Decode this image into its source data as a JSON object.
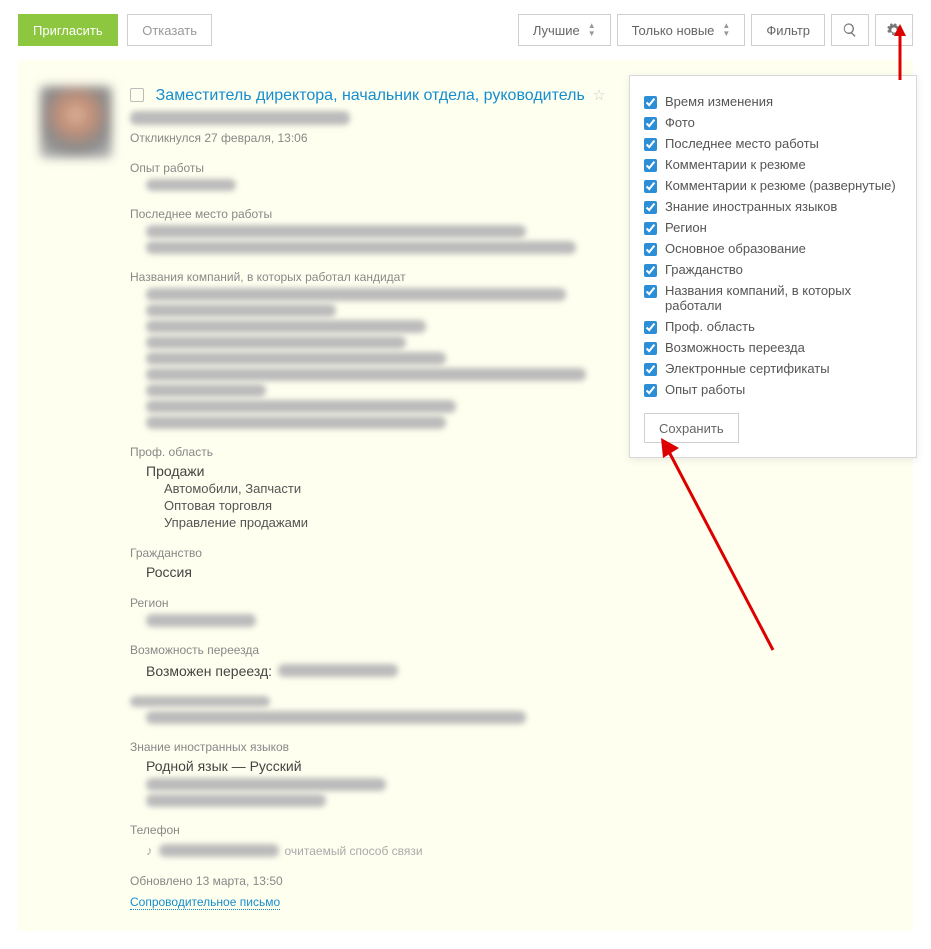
{
  "toolbar": {
    "invite": "Пригласить",
    "decline": "Отказать",
    "best": "Лучшие",
    "only_new": "Только новые",
    "filter": "Фильтр"
  },
  "resume": {
    "title": "Заместитель директора, начальник отдела, руководитель",
    "responded": "Откликнулся 27 февраля, 13:06",
    "exp_h": "Опыт работы",
    "last_job_h": "Последнее место работы",
    "companies_h": "Названия компаний, в которых работал кандидат",
    "prof_area_h": "Проф. область",
    "prof_area": "Продажи",
    "prof_sub1": "Автомобили, Запчасти",
    "prof_sub2": "Оптовая торговля",
    "prof_sub3": "Управление продажами",
    "citizenship_h": "Гражданство",
    "citizenship": "Россия",
    "region_h": "Регион",
    "relocation_h": "Возможность переезда",
    "relocation": "Возможен переезд:",
    "education_h": "Основное образование",
    "languages_h": "Знание иностранных языков",
    "languages": "Родной язык — Русский",
    "phone_h": "Телефон",
    "phone_note": "очитаемый способ связи",
    "updated": "Обновлено 13 марта, 13:50",
    "cover_letter": "Сопроводительное письмо"
  },
  "panel": {
    "items": [
      "Время изменения",
      "Фото",
      "Последнее место работы",
      "Комментарии к резюме",
      "Комментарии к резюме (развернутые)",
      "Знание иностранных языков",
      "Регион",
      "Основное образование",
      "Гражданство",
      "Названия компаний, в которых работали",
      "Проф. область",
      "Возможность переезда",
      "Электронные сертификаты",
      "Опыт работы"
    ],
    "save": "Сохранить"
  }
}
